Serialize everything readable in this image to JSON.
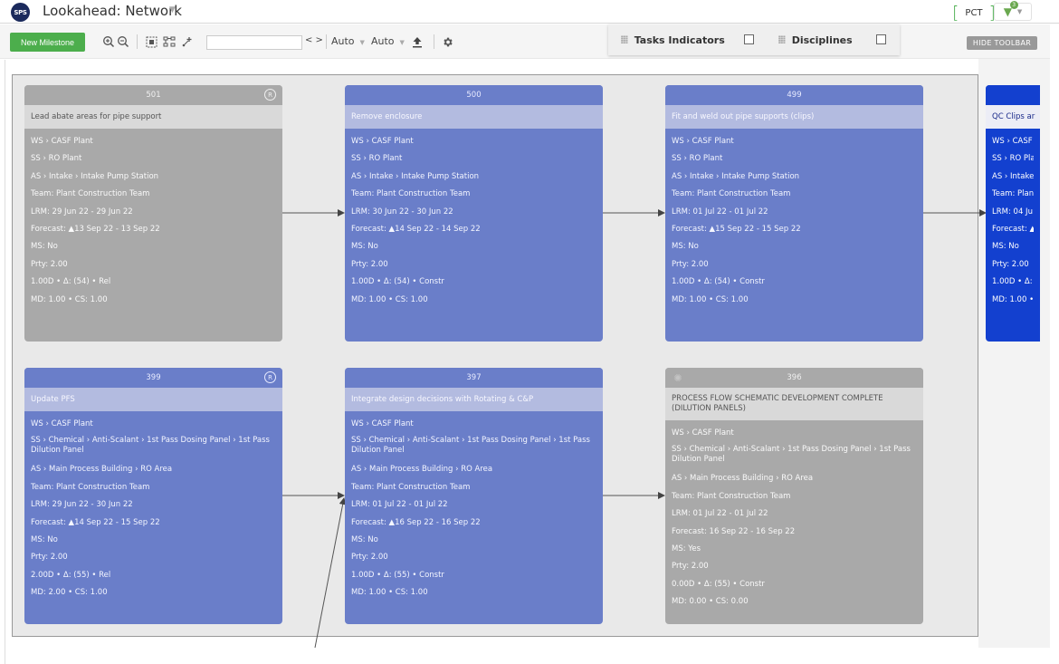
{
  "header": {
    "logo_text": "SPS",
    "title": "Lookahead: Network",
    "pct_label": "PCT",
    "filter_count": "3"
  },
  "toolbar": {
    "new_milestone_label": "New Milestone",
    "search_value": "",
    "nav_arrows": "< >",
    "auto1": "Auto",
    "auto2": "Auto",
    "tasks_indicators_label": "Tasks Indicators",
    "disciplines_label": "Disciplines",
    "hide_toolbar_label": "HIDE TOOLBAR"
  },
  "cards": [
    {
      "id": "501",
      "style": "gray",
      "badge": "R",
      "title": "Lead abate areas for pipe support",
      "rows": [
        "WS › CASF Plant",
        "SS › RO Plant",
        "AS › Intake › Intake Pump Station",
        "Team: Plant Construction Team",
        "LRM: 29 Jun 22 - 29 Jun 22",
        "Forecast: ▲13 Sep 22 - 13 Sep 22",
        "MS: No",
        "Prty: 2.00",
        "1.00D • Δ: (54) • Rel",
        "MD: 1.00 • CS: 1.00"
      ]
    },
    {
      "id": "500",
      "style": "blue",
      "badge": "",
      "title": "Remove enclosure",
      "rows": [
        "WS › CASF Plant",
        "SS › RO Plant",
        "AS › Intake › Intake Pump Station",
        "Team: Plant Construction Team",
        "LRM: 30 Jun 22 - 30 Jun 22",
        "Forecast: ▲14 Sep 22 - 14 Sep 22",
        "MS: No",
        "Prty: 2.00",
        "1.00D • Δ: (54) • Constr",
        "MD: 1.00 • CS: 1.00"
      ]
    },
    {
      "id": "499",
      "style": "blue",
      "badge": "",
      "title": "Fit and weld out pipe supports (clips)",
      "rows": [
        "WS › CASF Plant",
        "SS › RO Plant",
        "AS › Intake › Intake Pump Station",
        "Team: Plant Construction Team",
        "LRM: 01 Jul 22 - 01 Jul 22",
        "Forecast: ▲15 Sep 22 - 15 Sep 22",
        "MS: No",
        "Prty: 2.00",
        "1.00D • Δ: (54) • Constr",
        "MD: 1.00 • CS: 1.00"
      ]
    },
    {
      "id": "",
      "style": "bright",
      "badge": "",
      "title": "QC Clips ar",
      "rows": [
        "WS › CASF",
        "SS › RO Pla",
        "AS › Intake",
        "Team: Plan",
        "LRM: 04 Ju",
        "Forecast: ▲",
        "MS: No",
        "Prty: 2.00",
        "1.00D • Δ:",
        "MD: 1.00 •"
      ]
    },
    {
      "id": "399",
      "style": "blue",
      "badge": "R",
      "title": "Update PFS",
      "rows": [
        "WS › CASF Plant",
        "SS › Chemical › Anti-Scalant › 1st Pass Dosing Panel › 1st Pass Dilution Panel",
        "AS › Main Process Building › RO Area",
        "Team: Plant Construction Team",
        "LRM: 29 Jun 22 - 30 Jun 22",
        "Forecast: ▲14 Sep 22 - 15 Sep 22",
        "MS: No",
        "Prty: 2.00",
        "2.00D • Δ: (55) • Rel",
        "MD: 2.00 • CS: 1.00"
      ]
    },
    {
      "id": "397",
      "style": "blue",
      "badge": "",
      "title": "Integrate design decisions with Rotating & C&P",
      "rows": [
        "WS › CASF Plant",
        "SS › Chemical › Anti-Scalant › 1st Pass Dosing Panel › 1st Pass Dilution Panel",
        "AS › Main Process Building › RO Area",
        "Team: Plant Construction Team",
        "LRM: 01 Jul 22 - 01 Jul 22",
        "Forecast: ▲16 Sep 22 - 16 Sep 22",
        "MS: No",
        "Prty: 2.00",
        "1.00D • Δ: (55) • Constr",
        "MD: 1.00 • CS: 1.00"
      ]
    },
    {
      "id": "396",
      "style": "gray",
      "badge": "",
      "title": "PROCESS FLOW SCHEMATIC DEVELOPMENT COMPLETE (DILUTION PANELS)",
      "rows": [
        "WS › CASF Plant",
        "SS › Chemical › Anti-Scalant › 1st Pass Dosing Panel › 1st Pass Dilution Panel",
        "AS › Main Process Building › RO Area",
        "Team: Plant Construction Team",
        "LRM: 01 Jul 22 - 01 Jul 22",
        "Forecast: 16 Sep 22 - 16 Sep 22",
        "MS: Yes",
        "Prty: 2.00",
        "0.00D • Δ: (55) • Constr",
        "MD: 0.00 • CS: 0.00"
      ]
    }
  ]
}
